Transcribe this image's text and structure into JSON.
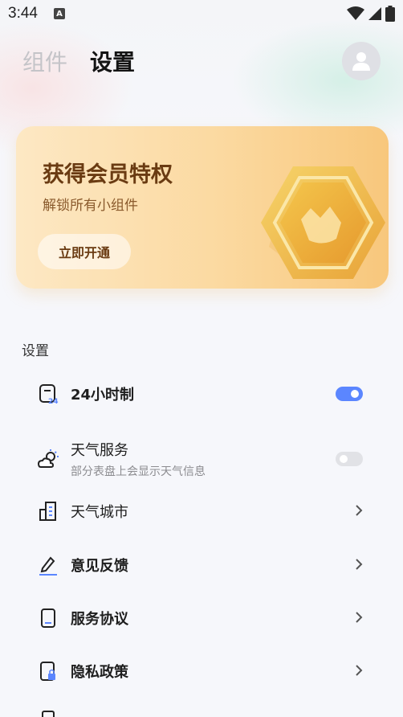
{
  "status_bar": {
    "time": "3:44",
    "app_icon_letter": "A"
  },
  "header": {
    "tabs": [
      {
        "label": "组件",
        "active": false
      },
      {
        "label": "设置",
        "active": true
      }
    ]
  },
  "promo": {
    "title": "获得会员特权",
    "subtitle": "解锁所有小组件",
    "button_label": "立即开通"
  },
  "settings": {
    "section_title": "设置",
    "items": [
      {
        "label": "24小时制",
        "icon": "clock-24-icon",
        "control": "toggle",
        "on": true
      },
      {
        "label": "天气服务",
        "sublabel": "部分表盘上会显示天气信息",
        "icon": "weather-icon",
        "control": "toggle",
        "on": false
      },
      {
        "label": "天气城市",
        "icon": "city-icon",
        "control": "chevron"
      },
      {
        "label": "意见反馈",
        "icon": "edit-icon",
        "control": "chevron"
      },
      {
        "label": "服务协议",
        "icon": "document-icon",
        "control": "chevron"
      },
      {
        "label": "隐私政策",
        "icon": "privacy-lock-icon",
        "control": "chevron"
      }
    ]
  },
  "colors": {
    "accent": "#5b86ff",
    "promo_text": "#6a3b12",
    "background": "#f6f7fb"
  }
}
